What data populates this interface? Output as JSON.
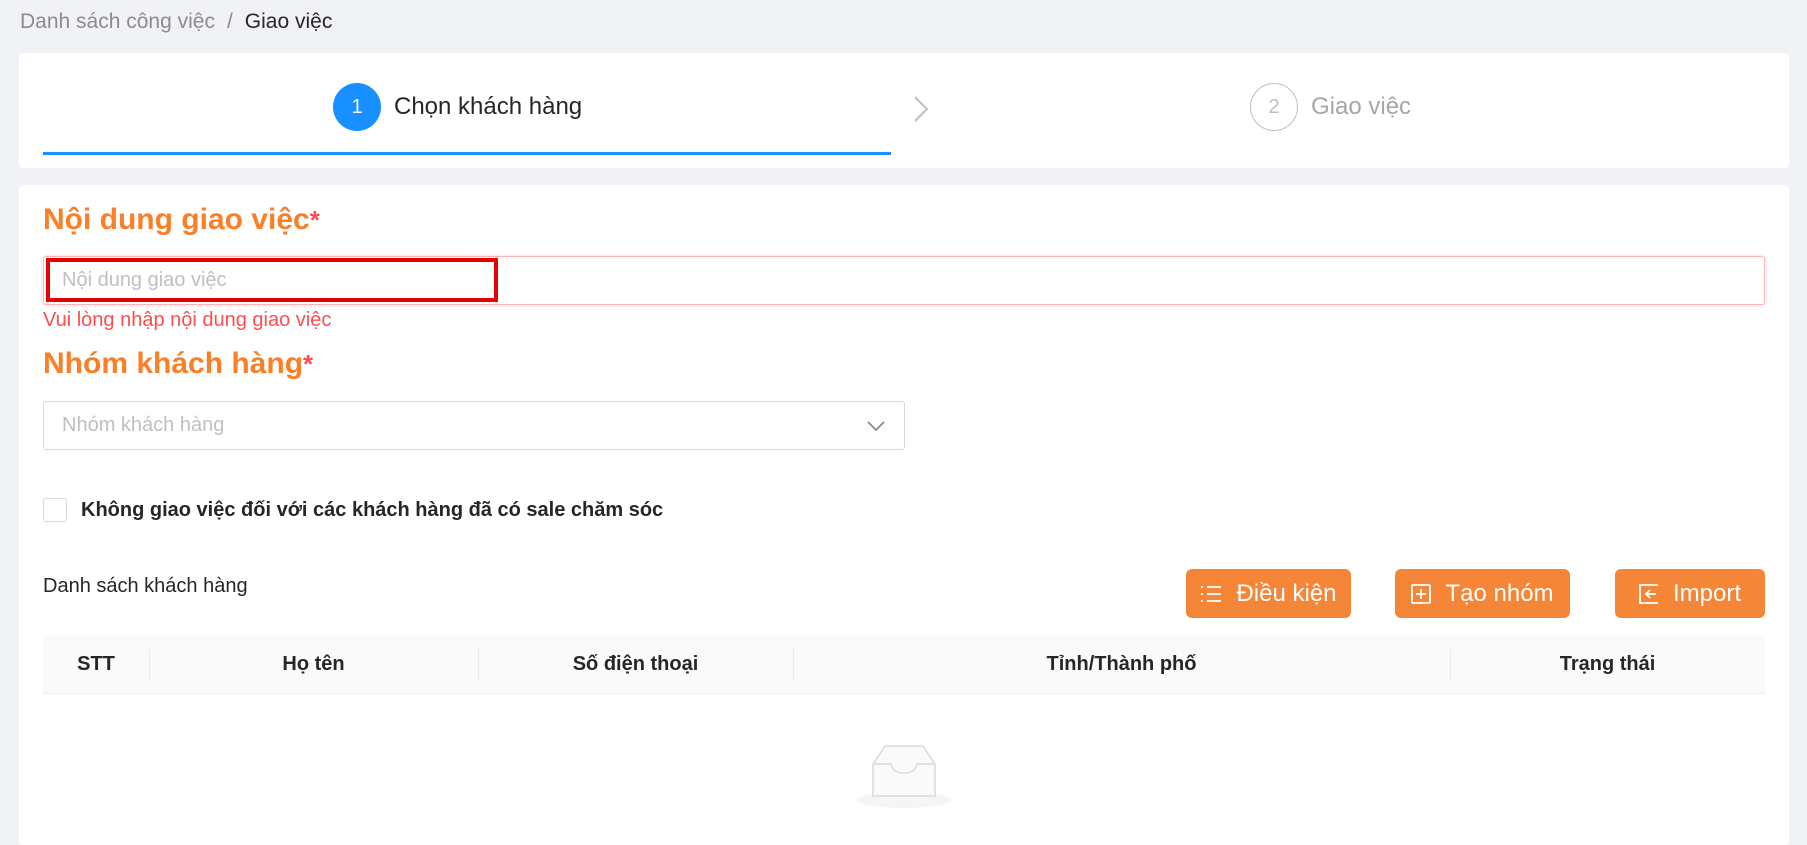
{
  "breadcrumb": {
    "parent": "Danh sách công việc",
    "separator": "/",
    "current": "Giao việc"
  },
  "steps": [
    {
      "number": "1",
      "title": "Chọn khách hàng",
      "state": "active"
    },
    {
      "number": "2",
      "title": "Giao việc",
      "state": "waiting"
    }
  ],
  "form": {
    "task_title": "Nội dung giao việc",
    "task_required": "*",
    "task_placeholder": "Nội dung giao việc",
    "task_value": "",
    "task_error": "Vui lòng nhập nội dung giao việc",
    "group_title": "Nhóm khách hàng",
    "group_required": "*",
    "group_placeholder": "Nhóm khách hàng",
    "exclude_label": "Không giao việc đối với các khách hàng đã có sale chăm sóc",
    "exclude_checked": false
  },
  "customer_list": {
    "label": "Danh sách khách hàng",
    "buttons": {
      "conditions": "Điều kiện",
      "create_group": "Tạo nhóm",
      "import": "Import"
    },
    "columns": [
      "STT",
      "Họ tên",
      "Số điện thoại",
      "Tỉnh/Thành phố",
      "Trạng thái"
    ],
    "rows": []
  },
  "colors": {
    "primary": "#1890ff",
    "accent_orange": "#f58637",
    "title_orange": "#fa7f27",
    "error": "#ff4d4f",
    "highlight": "#e60000"
  },
  "icons": {
    "step_arrow": "chevron-right-icon",
    "select_arrow": "chevron-down-icon",
    "conditions": "list-icon",
    "create_group": "plus-square-icon",
    "import": "import-icon",
    "empty": "empty-inbox-icon"
  }
}
